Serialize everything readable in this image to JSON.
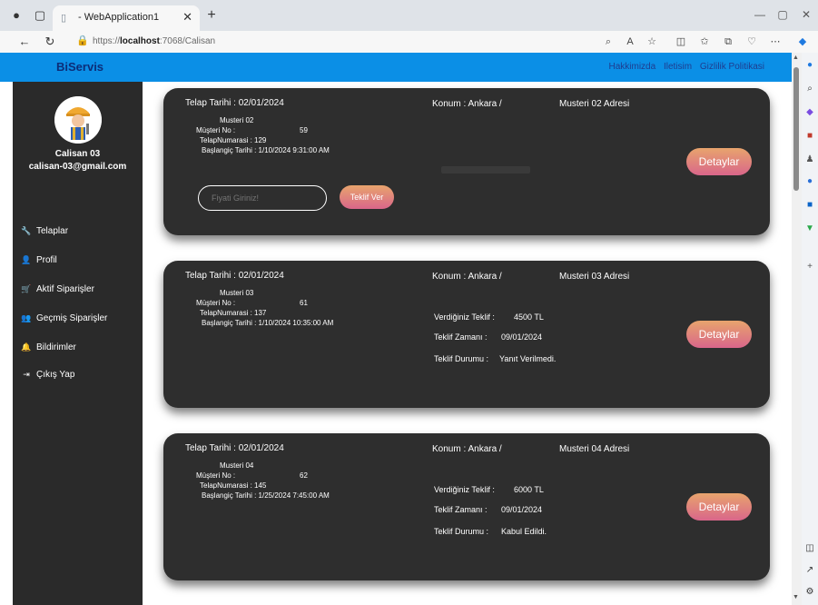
{
  "browser": {
    "tab_title": "- WebApplication1",
    "url_prefix": "https://",
    "url_host": "localhost",
    "url_path": ":7068/Calisan"
  },
  "site": {
    "brand": "BiServis",
    "nav": [
      "Hakkimizda",
      "Iletisim",
      "Gizlilik Politikasi"
    ]
  },
  "user": {
    "name": "Calisan 03",
    "email": "calisan-03@gmail.com"
  },
  "menu": [
    {
      "label": "Telaplar",
      "icon": "wrench-icon"
    },
    {
      "label": "Profil",
      "icon": "user-icon"
    },
    {
      "label": "Aktif Siparişler",
      "icon": "cart-icon"
    },
    {
      "label": "Geçmiş Siparişler",
      "icon": "users-icon"
    },
    {
      "label": "Bildirimler",
      "icon": "bell-icon"
    },
    {
      "label": "Çıkış Yap",
      "icon": "sign-out-icon"
    }
  ],
  "cards": [
    {
      "date": "Telap Tarihi : 02/01/2024",
      "customer": "Musteri 02",
      "no_label": "Müşteri No :",
      "no_value": "59",
      "telap_no": "TelapNumarasi : 129",
      "start": "Başlangiç Tarihi : 1/10/2024 9:31:00 AM",
      "location": "Konum : Ankara /",
      "address": "Musteri 02 Adresi",
      "price_placeholder": "Fiyati Giriniz!",
      "offer_button": "Teklif Ver",
      "detail_button": "Detaylar"
    },
    {
      "date": "Telap Tarihi : 02/01/2024",
      "customer": "Musteri 03",
      "no_label": "Müşteri No :",
      "no_value": "61",
      "telap_no": "TelapNumarasi : 137",
      "start": "Başlangiç Tarihi : 1/10/2024 10:35:00 AM",
      "location": "Konum : Ankara /",
      "address": "Musteri 03 Adresi",
      "offer_label": "Verdiğiniz Teklif :",
      "offer_value": "4500 TL",
      "time_label": "Teklif Zamanı :",
      "time_value": "09/01/2024",
      "status_label": "Teklif Durumu :",
      "status_value": "Yanıt Verilmedi.",
      "detail_button": "Detaylar"
    },
    {
      "date": "Telap Tarihi : 02/01/2024",
      "customer": "Musteri 04",
      "no_label": "Müşteri No :",
      "no_value": "62",
      "telap_no": "TelapNumarasi : 145",
      "start": "Başlangiç Tarihi : 1/25/2024 7:45:00 AM",
      "location": "Konum : Ankara /",
      "address": "Musteri 04 Adresi",
      "offer_label": "Verdiğiniz Teklif :",
      "offer_value": "6000 TL",
      "time_label": "Teklif Zamanı :",
      "time_value": "09/01/2024",
      "status_label": "Teklif Durumu :",
      "status_value": "Kabul Edildi.",
      "detail_button": "Detaylar"
    }
  ]
}
